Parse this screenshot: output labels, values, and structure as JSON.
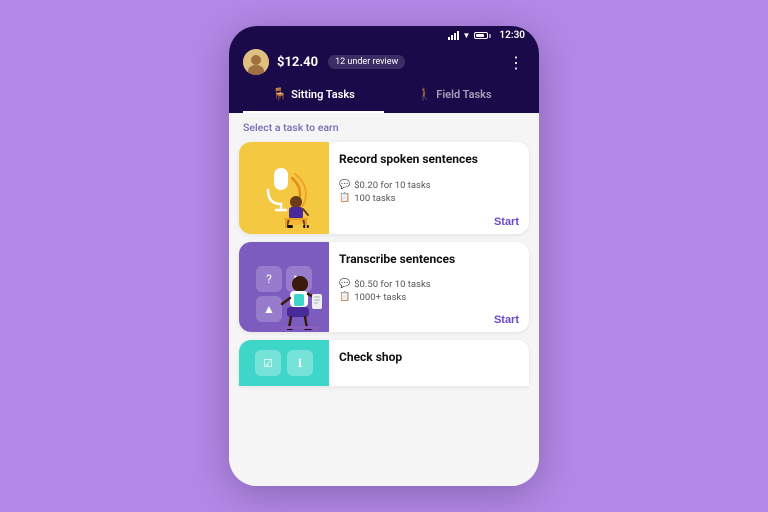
{
  "status_bar": {
    "time": "12:30"
  },
  "app_bar": {
    "balance": "$12.40",
    "review_badge": "12 under review",
    "more_icon": "⋮"
  },
  "tabs": [
    {
      "label": "Sitting Tasks",
      "icon": "🪑",
      "active": true
    },
    {
      "label": "Field Tasks",
      "icon": "🚶",
      "active": false
    }
  ],
  "section_label": "Select a task to earn",
  "cards": [
    {
      "title": "Record spoken sentences",
      "meta1_icon": "💬",
      "meta1": "$0.20 for 10 tasks",
      "meta2_icon": "📋",
      "meta2": "100 tasks",
      "action": "Start",
      "color": "yellow"
    },
    {
      "title": "Transcribe sentences",
      "meta1_icon": "💬",
      "meta1": "$0.50 for 10 tasks",
      "meta2_icon": "📋",
      "meta2": "1000+ tasks",
      "action": "Start",
      "color": "purple"
    }
  ],
  "partial_card": {
    "title": "Check shop",
    "color": "teal"
  }
}
